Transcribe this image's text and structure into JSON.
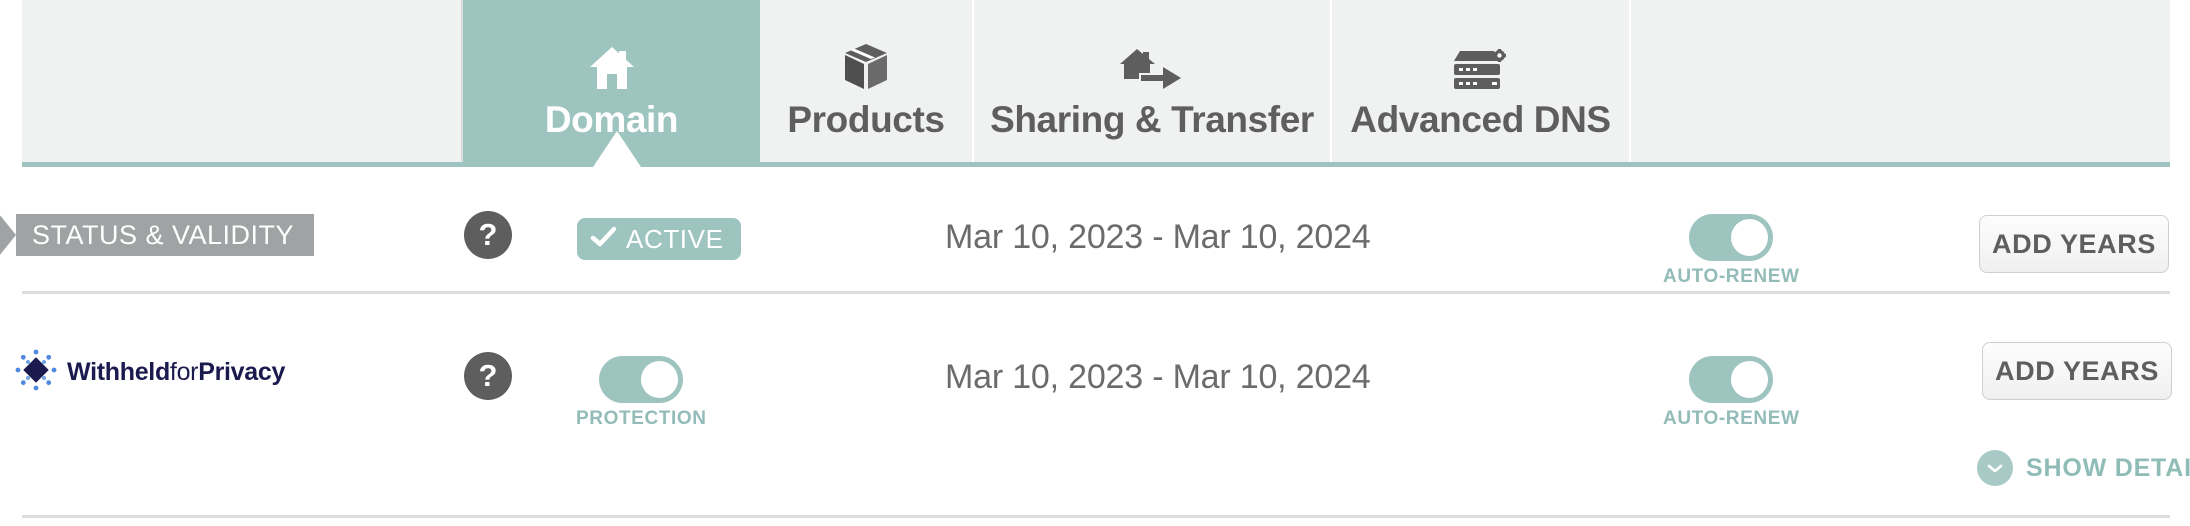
{
  "theme": {
    "accent_teal": "#9ec4c0",
    "ribbon_gray": "#a0a3a4",
    "text_gray": "#5e5e5e",
    "logo_navy": "#1b1a4e",
    "logo_dot_blue": "#3b6fd4"
  },
  "tabs": [
    {
      "label": "",
      "icon": "none",
      "active": false,
      "spacer": true
    },
    {
      "label": "Domain",
      "icon": "house-icon",
      "active": true,
      "spacer": false
    },
    {
      "label": "Products",
      "icon": "box-icon",
      "active": false,
      "spacer": false
    },
    {
      "label": "Sharing & Transfer",
      "icon": "house-arrow-icon",
      "active": false,
      "spacer": false
    },
    {
      "label": "Advanced DNS",
      "icon": "server-gear-icon",
      "active": false,
      "spacer": false
    },
    {
      "label": "",
      "icon": "none",
      "active": false,
      "spacer": true
    }
  ],
  "status_row": {
    "ribbon_label": "STATUS & VALIDITY",
    "help_label": "?",
    "status_badge": "ACTIVE",
    "date_range": "Mar 10, 2023 - Mar 10, 2024",
    "auto_renew_label": "AUTO-RENEW",
    "auto_renew_on": true,
    "add_years_label": "ADD YEARS"
  },
  "privacy_row": {
    "logo_part_1": "Withheld",
    "logo_part_2": "for",
    "logo_part_3": "Privacy",
    "help_label": "?",
    "protection_label": "PROTECTION",
    "protection_on": true,
    "date_range": "Mar 10, 2023 - Mar 10, 2024",
    "auto_renew_label": "AUTO-RENEW",
    "auto_renew_on": true,
    "add_years_label": "ADD YEARS"
  },
  "footer": {
    "show_details_label": "SHOW DETAILS"
  }
}
